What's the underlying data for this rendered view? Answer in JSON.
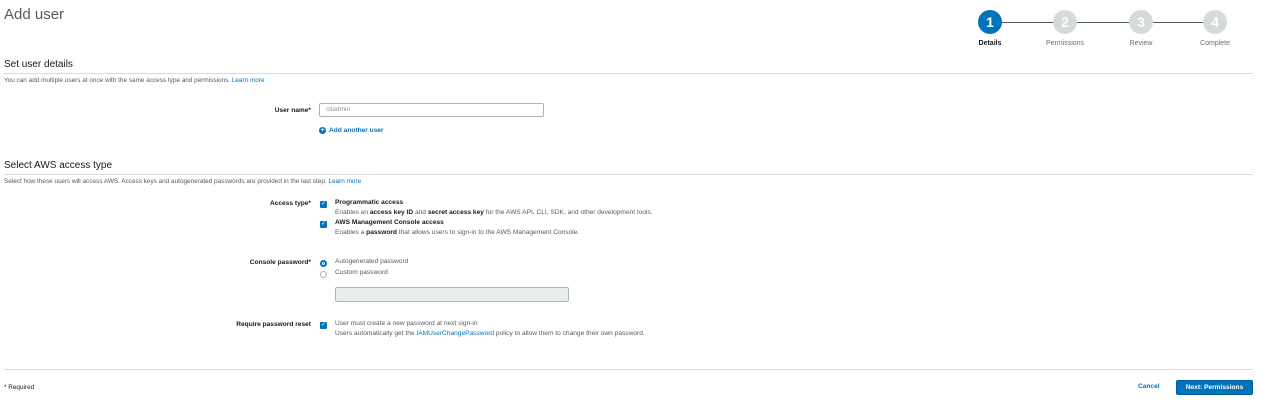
{
  "page": {
    "title": "Add user"
  },
  "stepper": {
    "steps": [
      {
        "number": "1",
        "label": "Details"
      },
      {
        "number": "2",
        "label": "Permissions"
      },
      {
        "number": "3",
        "label": "Review"
      },
      {
        "number": "4",
        "label": "Complete"
      }
    ],
    "active_step": 1
  },
  "user_details": {
    "title": "Set user details",
    "description": "You can add multiple users at once with the same access type and permissions.",
    "learn_more": "Learn more",
    "user_name_label": "User name*",
    "user_name_value": "cliadmin",
    "add_another": "Add another user"
  },
  "access_type": {
    "title": "Select AWS access type",
    "description": "Select how these users will access AWS. Access keys and autogenerated passwords are provided in the last step.",
    "learn_more": "Learn more",
    "label": "Access type*",
    "programmatic": {
      "title": "Programmatic access",
      "desc_pre": "Enables an",
      "desc_b1": "access key ID",
      "desc_mid": "and",
      "desc_b2": "secret access key",
      "desc_post": "for the AWS API, CLI, SDK, and other development tools.",
      "checked": true
    },
    "console": {
      "title": "AWS Management Console access",
      "desc_pre": "Enables a",
      "desc_b1": "password",
      "desc_post": "that allows users to sign-in to the AWS Management Console.",
      "checked": true
    }
  },
  "console_password": {
    "label": "Console password*",
    "autogenerated": "Autogenerated password",
    "custom": "Custom password",
    "selected": "autogenerated",
    "custom_value": ""
  },
  "password_reset": {
    "label": "Require password reset",
    "text": "User must create a new password at next sign-in",
    "desc_pre": "Users automatically get the",
    "policy_link": "IAMUserChangePassword",
    "desc_post": "policy to allow them to change their own password.",
    "checked": true
  },
  "footer": {
    "required_note": "* Required",
    "cancel": "Cancel",
    "next": "Next: Permissions"
  },
  "colors": {
    "accent": "#0073bb",
    "inactive_step": "#d5dbdb"
  }
}
